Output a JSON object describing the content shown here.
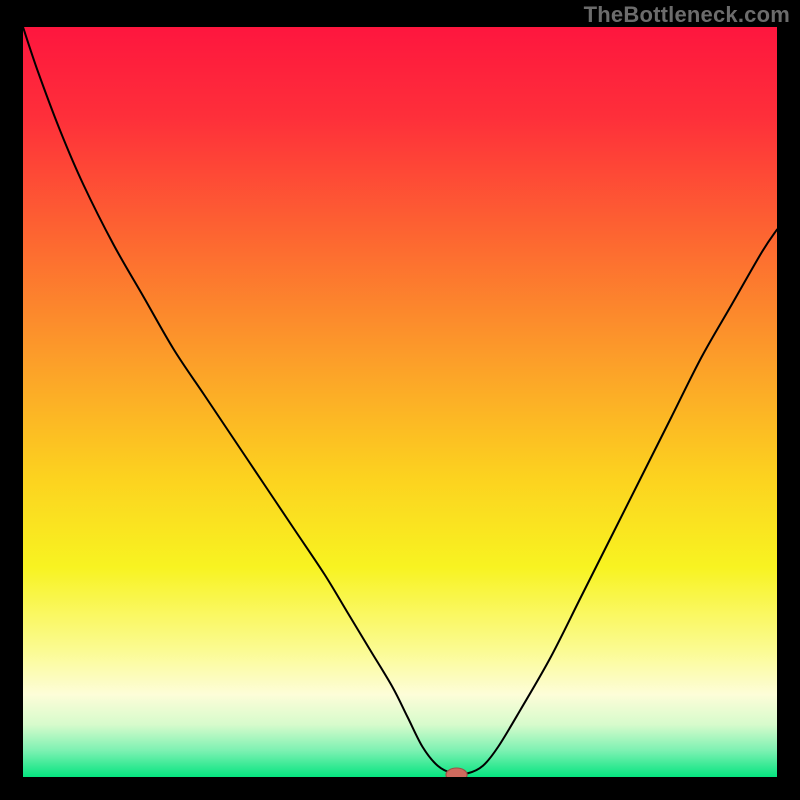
{
  "watermark": "TheBottleneck.com",
  "colors": {
    "frame": "#000000",
    "stroke": "#000000",
    "marker_fill": "#cf6a5e",
    "marker_stroke": "#9c5048",
    "gradient_stops": [
      {
        "offset": 0.0,
        "color": "#fe163e"
      },
      {
        "offset": 0.12,
        "color": "#fe2f3a"
      },
      {
        "offset": 0.28,
        "color": "#fd6631"
      },
      {
        "offset": 0.45,
        "color": "#fca029"
      },
      {
        "offset": 0.6,
        "color": "#fcd21f"
      },
      {
        "offset": 0.72,
        "color": "#f8f321"
      },
      {
        "offset": 0.83,
        "color": "#fbfb91"
      },
      {
        "offset": 0.89,
        "color": "#fdfdd8"
      },
      {
        "offset": 0.93,
        "color": "#d7fbcc"
      },
      {
        "offset": 0.965,
        "color": "#7cf1b2"
      },
      {
        "offset": 1.0,
        "color": "#05e47f"
      }
    ]
  },
  "chart_data": {
    "type": "line",
    "title": "",
    "xlabel": "",
    "ylabel": "",
    "xlim": [
      0,
      100
    ],
    "ylim": [
      0,
      100
    ],
    "x": [
      0,
      2,
      5,
      8,
      12,
      16,
      20,
      24,
      28,
      32,
      36,
      40,
      43,
      46,
      49,
      51,
      53,
      55,
      57,
      59,
      61,
      63,
      66,
      70,
      74,
      78,
      82,
      86,
      90,
      94,
      98,
      100
    ],
    "values": [
      100,
      94,
      86,
      79,
      71,
      64,
      57,
      51,
      45,
      39,
      33,
      27,
      22,
      17,
      12,
      8,
      4,
      1.5,
      0.5,
      0.5,
      1.5,
      4,
      9,
      16,
      24,
      32,
      40,
      48,
      56,
      63,
      70,
      73
    ],
    "marker": {
      "x": 57.5,
      "y": 0.3,
      "rx": 1.4,
      "ry": 0.9
    },
    "annotations": []
  }
}
